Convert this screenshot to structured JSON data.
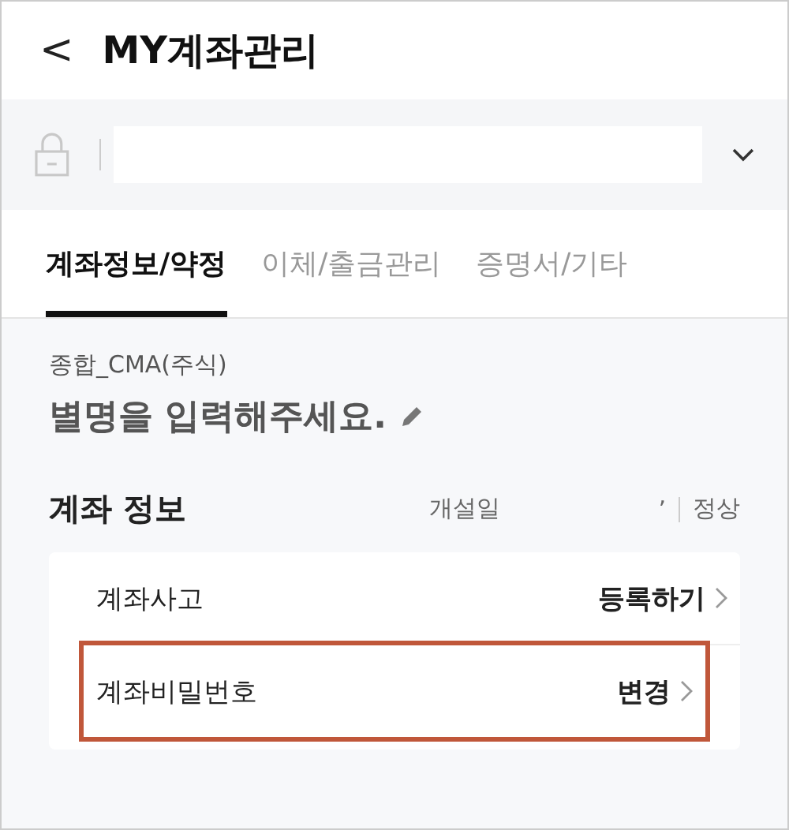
{
  "header": {
    "back": "<",
    "title": "MY계좌관리"
  },
  "tabs": [
    {
      "label": "계좌정보/약정",
      "selected": true
    },
    {
      "label": "이체/출금관리",
      "selected": false
    },
    {
      "label": "증명서/기타",
      "selected": false
    }
  ],
  "account": {
    "type": "종합_CMA(주식)",
    "nickname": "별명을 입력해주세요."
  },
  "section": {
    "title": "계좌 정보",
    "open_date_label": "개설일",
    "open_date_value": "’",
    "status": "정상"
  },
  "rows": [
    {
      "label": "계좌사고",
      "action": "등록하기",
      "highlighted": false
    },
    {
      "label": "계좌비밀번호",
      "action": "변경",
      "highlighted": true
    }
  ]
}
